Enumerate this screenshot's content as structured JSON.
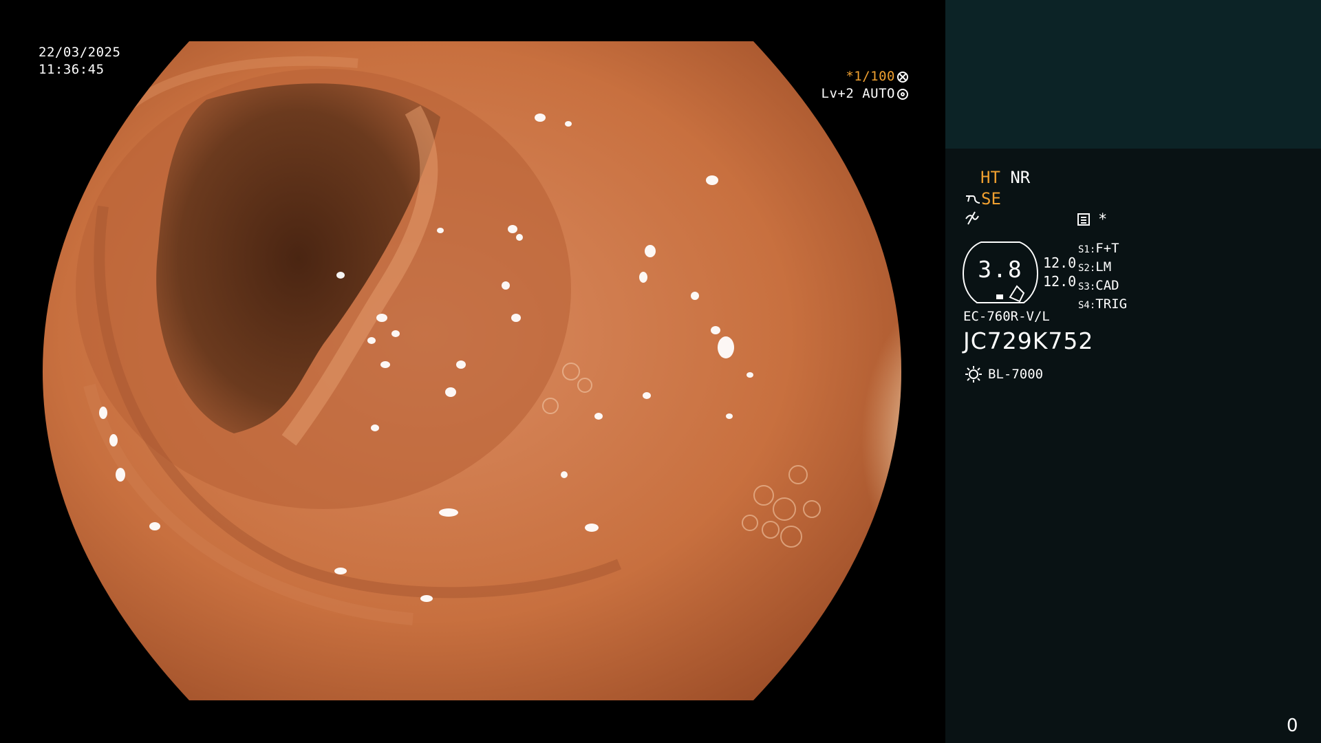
{
  "osd": {
    "date": "22/03/2025",
    "time": "11:36:45",
    "shutter": "*1/100",
    "shutter_icon": "wheel-icon",
    "level": "Lv+2 AUTO",
    "level_icon": "iris-icon"
  },
  "panel": {
    "ht": "HT",
    "nr": "NR",
    "se": "SE",
    "icons": {
      "se": "scope-icon",
      "filter": "filter-icon",
      "menu": "menu-icon"
    },
    "asterisk": "*",
    "gauge_value": "3.8",
    "gauge_nums": [
      "12.0",
      "12.0"
    ],
    "scope_switches": [
      {
        "key": "S1:",
        "value": "F+T"
      },
      {
        "key": "S2:",
        "value": "LM"
      },
      {
        "key": "S3:",
        "value": "CAD"
      },
      {
        "key": "S4:",
        "value": "TRIG"
      }
    ],
    "model": "EC-760R-V/L",
    "serial": "JC729K752",
    "light_source": "BL-7000",
    "light_icon": "sun-icon",
    "counter": "0"
  },
  "colors": {
    "orange_text": "#f0a030",
    "panel_bg": "#091214",
    "thumb_bg": "#0c2326",
    "mucosa": "#c86e45",
    "lumen": "#5a3018"
  }
}
